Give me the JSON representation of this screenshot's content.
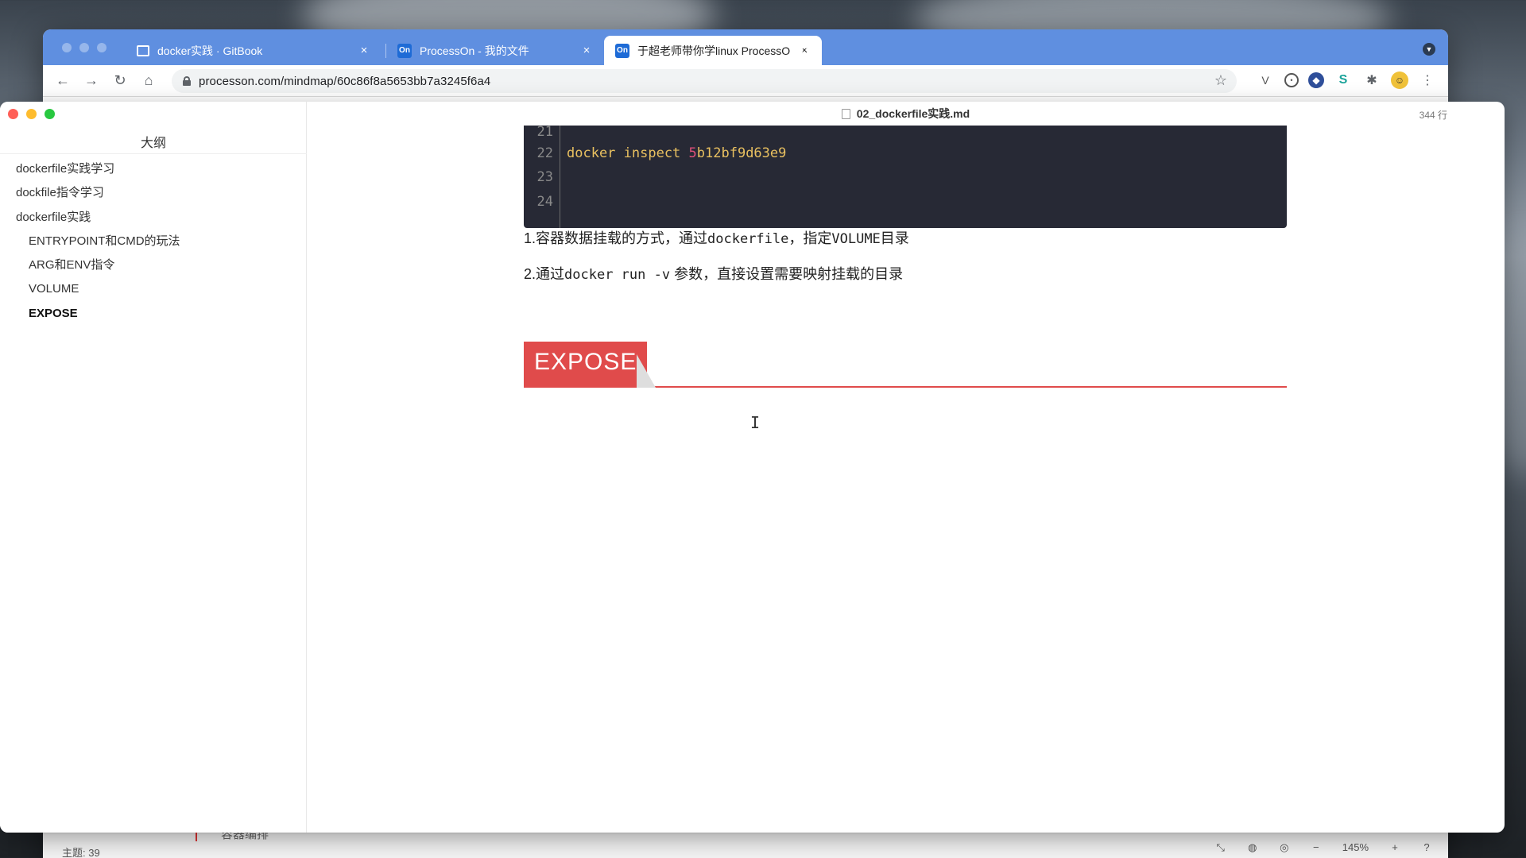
{
  "browser": {
    "tabs": [
      {
        "title": "docker实践 · GitBook",
        "favicon": "book-icon"
      },
      {
        "title": "ProcessOn - 我的文件",
        "favicon": "On"
      },
      {
        "title": "于超老师带你学linux ProcessOn",
        "favicon": "On"
      }
    ],
    "active_tab": 2,
    "close_glyph": "×",
    "new_tab_glyph": "+",
    "url": "processon.com/mindmap/60c86f8a5653bb7a3245f6a4",
    "accent_color": "#5f8fe0"
  },
  "typora": {
    "file_name": "02_dockerfile实践.md",
    "line_count": "344 行",
    "sidebar": {
      "header": "大纲",
      "items": [
        {
          "label": "dockerfile实践学习",
          "level": 1
        },
        {
          "label": "dockfile指令学习",
          "level": 1
        },
        {
          "label": "dockerfile实践",
          "level": 1
        },
        {
          "label": "ENTRYPOINT和CMD的玩法",
          "level": 2
        },
        {
          "label": "ARG和ENV指令",
          "level": 2
        },
        {
          "label": "VOLUME",
          "level": 2
        },
        {
          "label": "EXPOSE",
          "level": 2,
          "active": true
        }
      ]
    },
    "code": {
      "line_numbers": [
        "21",
        "22",
        "23",
        "24"
      ],
      "line22_cmd": "docker inspect ",
      "line22_id_first": "5",
      "line22_id_rest": "b12bf9d63e9"
    },
    "paragraphs": {
      "p1_a": "1.容器数据挂载的方式，通过",
      "p1_b": "dockerfile",
      "p1_c": "，指定",
      "p1_d": "VOLUME",
      "p1_e": "目录",
      "p2_a": "2.通过",
      "p2_b": "docker run -v",
      "p2_c": " 参数，直接设置需要映射挂载的目录"
    },
    "heading": "EXPOSE",
    "heading_color": "#e04b4b",
    "code_bg": "#272935"
  },
  "processon_status": {
    "topics": "主题: 39",
    "behind_text": "容器编排",
    "zoom": "145%",
    "minus": "−",
    "plus": "+"
  }
}
